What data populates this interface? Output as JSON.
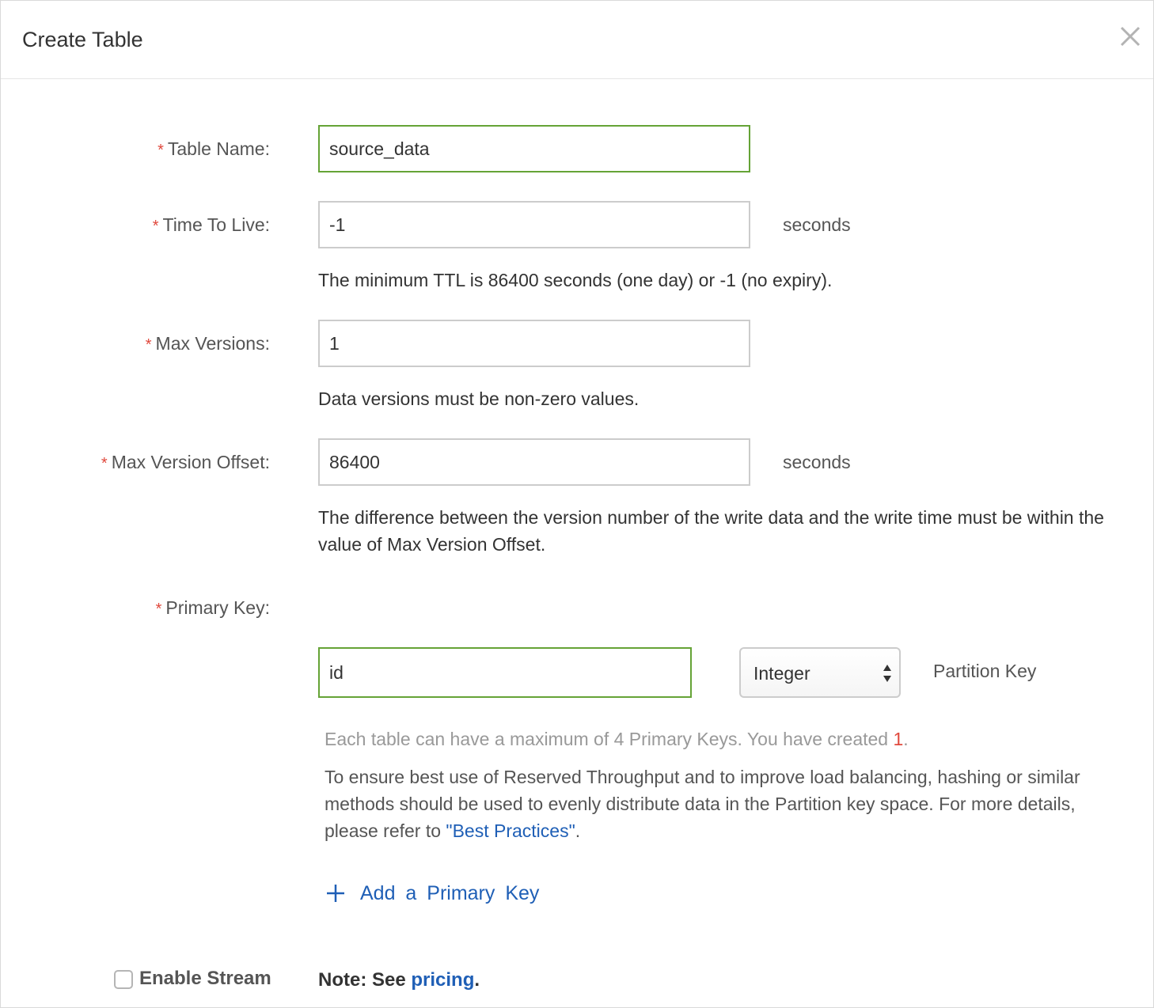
{
  "dialog": {
    "title": "Create Table",
    "close_icon": "close-icon"
  },
  "form": {
    "required_marker": "*",
    "table_name": {
      "label": "Table Name:",
      "value": "source_data"
    },
    "time_to_live": {
      "label": "Time To Live:",
      "value": "-1",
      "unit": "seconds",
      "help": "The minimum TTL is 86400 seconds (one day) or -1 (no expiry)."
    },
    "max_versions": {
      "label": "Max Versions:",
      "value": "1",
      "help": "Data versions must be non-zero values."
    },
    "max_version_offset": {
      "label": "Max Version Offset:",
      "value": "86400",
      "unit": "seconds",
      "help": "The difference between the version number of the write data and the write time must be within the value of Max Version Offset."
    },
    "primary_key": {
      "label": "Primary Key:",
      "name_value": "id",
      "type_value": "Integer",
      "role": "Partition Key",
      "limit_text": "Each table can have a maximum of 4 Primary Keys. You have created ",
      "created_count": "1",
      "limit_end": ".",
      "advice_text": "To ensure best use of Reserved Throughput and to improve load balancing, hashing or similar methods should be used to evenly distribute data in the Partition key space. For more details, please refer to ",
      "advice_link": "\"Best Practices\"",
      "advice_end": ".",
      "add_label": "Add a Primary Key"
    },
    "stream": {
      "label": "Enable Stream",
      "checked": false,
      "note_prefix": "Note: See ",
      "note_link": "pricing",
      "note_suffix": "."
    }
  },
  "colors": {
    "valid_border": "#65a336",
    "required": "#e0483c",
    "link": "#1f5fb6"
  }
}
